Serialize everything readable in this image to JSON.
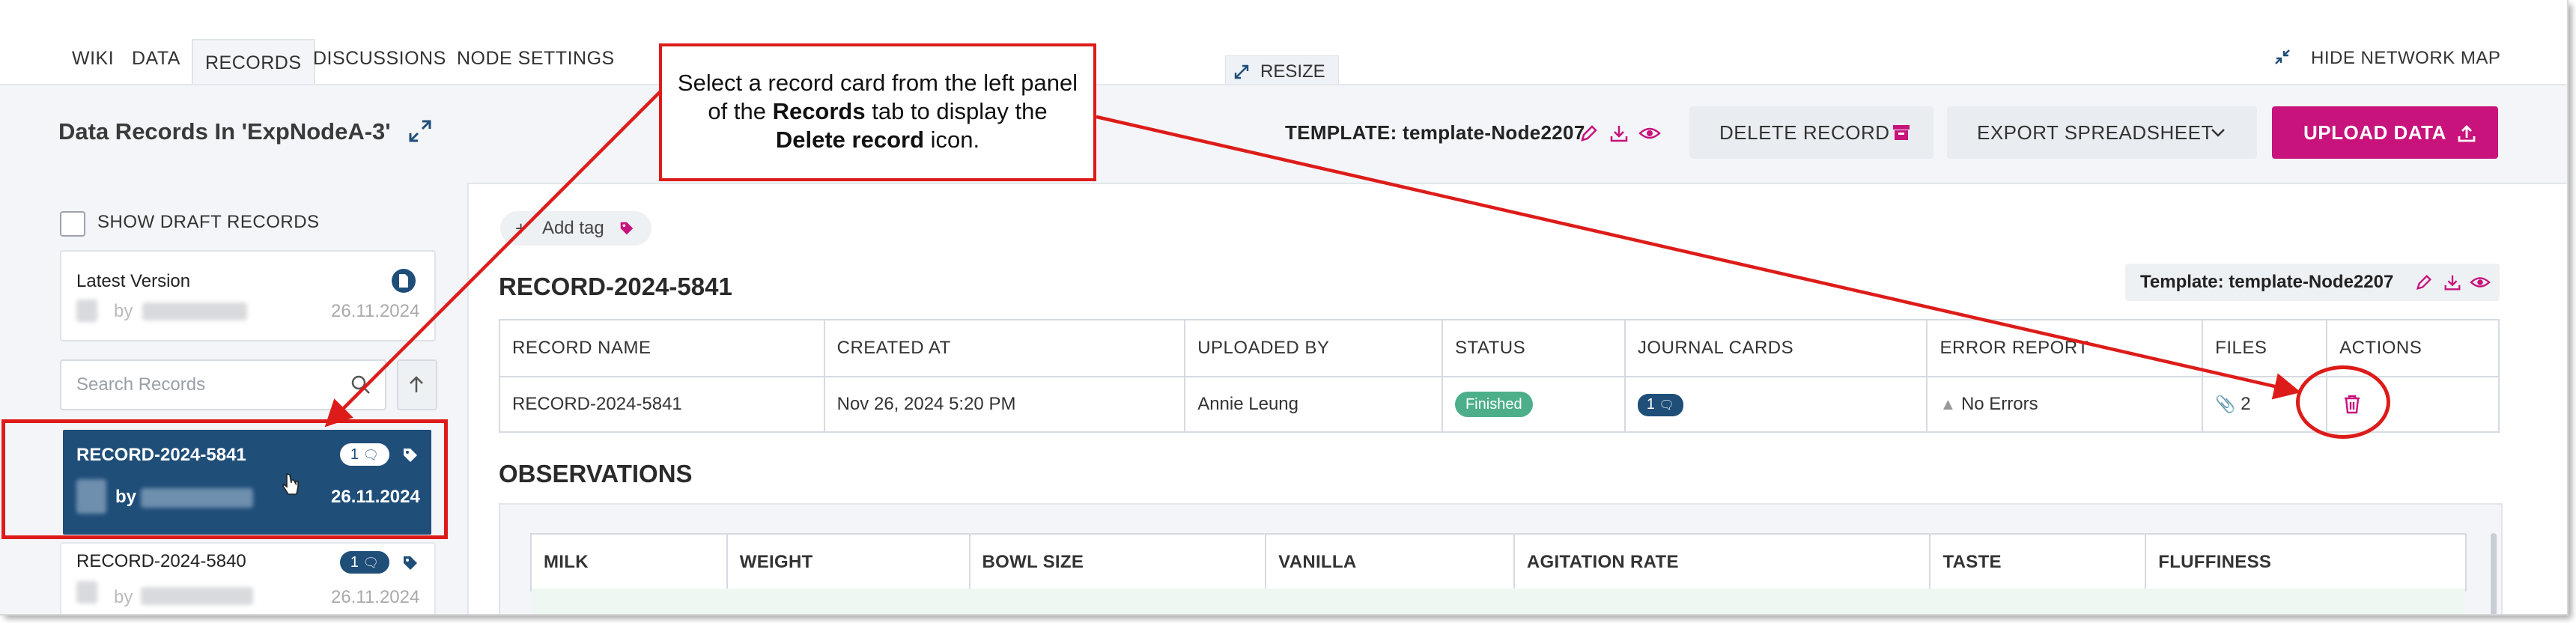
{
  "nav": {
    "tabs": [
      "WIKI",
      "DATA",
      "RECORDS",
      "DISCUSSIONS",
      "NODE SETTINGS"
    ],
    "active_tab": "RECORDS",
    "resize": "RESIZE",
    "hide_network_map": "HIDE NETWORK MAP"
  },
  "header": {
    "title": "Data Records In 'ExpNodeA-3'",
    "template_label": "TEMPLATE: template-Node2207",
    "delete_record": "DELETE RECORD",
    "export_spreadsheet": "EXPORT SPREADSHEET",
    "upload_data": "UPLOAD DATA"
  },
  "sidebar": {
    "show_draft": "SHOW DRAFT RECORDS",
    "latest": {
      "title": "Latest Version",
      "by": "by",
      "date": "26.11.2024"
    },
    "search_placeholder": "Search Records",
    "cards": [
      {
        "title": "RECORD-2024-5841",
        "count": "1",
        "by": "by",
        "date": "26.11.2024",
        "selected": true
      },
      {
        "title": "RECORD-2024-5840",
        "count": "1",
        "by": "by",
        "date": "26.11.2024",
        "selected": false
      }
    ]
  },
  "main": {
    "add_tag": "Add tag",
    "record_title": "RECORD-2024-5841",
    "template_chip": "Template: template-Node2207",
    "columns": [
      "RECORD NAME",
      "CREATED AT",
      "UPLOADED BY",
      "STATUS",
      "JOURNAL CARDS",
      "ERROR REPORT",
      "FILES",
      "ACTIONS"
    ],
    "row": {
      "name": "RECORD-2024-5841",
      "created": "Nov 26, 2024 5:20 PM",
      "uploaded_by": "Annie Leung",
      "status": "Finished",
      "journal": "1",
      "error": "No Errors",
      "files": "2"
    },
    "observations_title": "OBSERVATIONS",
    "obs_columns": [
      "MILK",
      "WEIGHT",
      "BOWL SIZE",
      "VANILLA",
      "AGITATION RATE",
      "TASTE",
      "FLUFFINESS"
    ]
  },
  "annotation": {
    "line1": "Select a record card from the left panel",
    "line2a": "of the ",
    "line2b": "Records",
    "line2c": " tab to display the",
    "line3a": "Delete record",
    "line3b": " icon."
  },
  "colors": {
    "brand_pink": "#c8127c",
    "selected_blue": "#1f4e79",
    "annotation_red": "#dd1c1a",
    "status_green": "#4caf8a"
  }
}
